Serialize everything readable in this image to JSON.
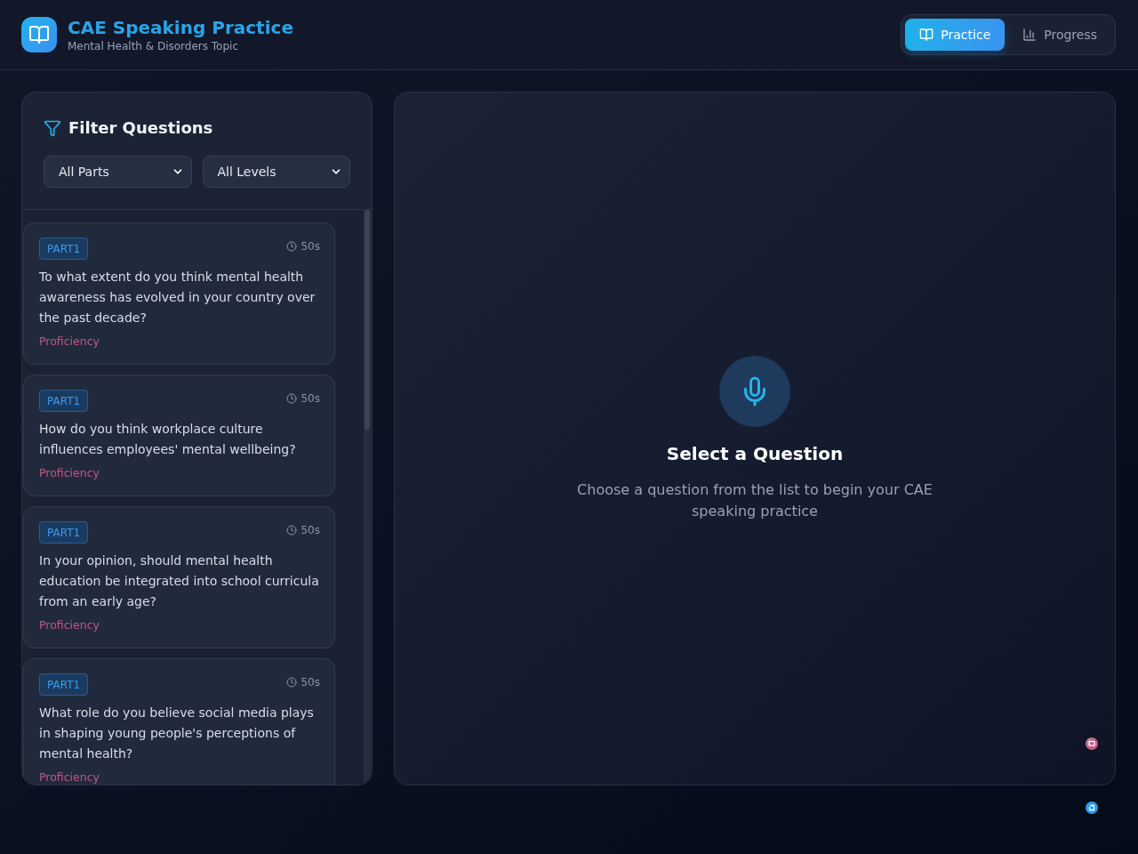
{
  "header": {
    "title": "CAE Speaking Practice",
    "subtitle": "Mental Health & Disorders Topic"
  },
  "nav_tabs": [
    {
      "label": "Practice",
      "selected": true
    },
    {
      "label": "Progress",
      "selected": false
    }
  ],
  "filter_panel": {
    "title": "Filter Questions",
    "selects": [
      {
        "value": "All Parts"
      },
      {
        "value": "All Levels"
      }
    ]
  },
  "questions": [
    {
      "part": "PART1",
      "duration": "50s",
      "text": "To what extent do you think mental health awareness has evolved in your country over the past decade?",
      "level": "Proficiency"
    },
    {
      "part": "PART1",
      "duration": "50s",
      "text": "How do you think workplace culture influences employees' mental wellbeing?",
      "level": "Proficiency"
    },
    {
      "part": "PART1",
      "duration": "50s",
      "text": "In your opinion, should mental health education be integrated into school curricula from an early age?",
      "level": "Proficiency"
    },
    {
      "part": "PART1",
      "duration": "50s",
      "text": "What role do you believe social media plays in shaping young people's perceptions of mental health?",
      "level": "Proficiency"
    }
  ],
  "empty_state": {
    "title": "Select a Question",
    "description": "Choose a question from the list to begin your CAE speaking practice"
  }
}
